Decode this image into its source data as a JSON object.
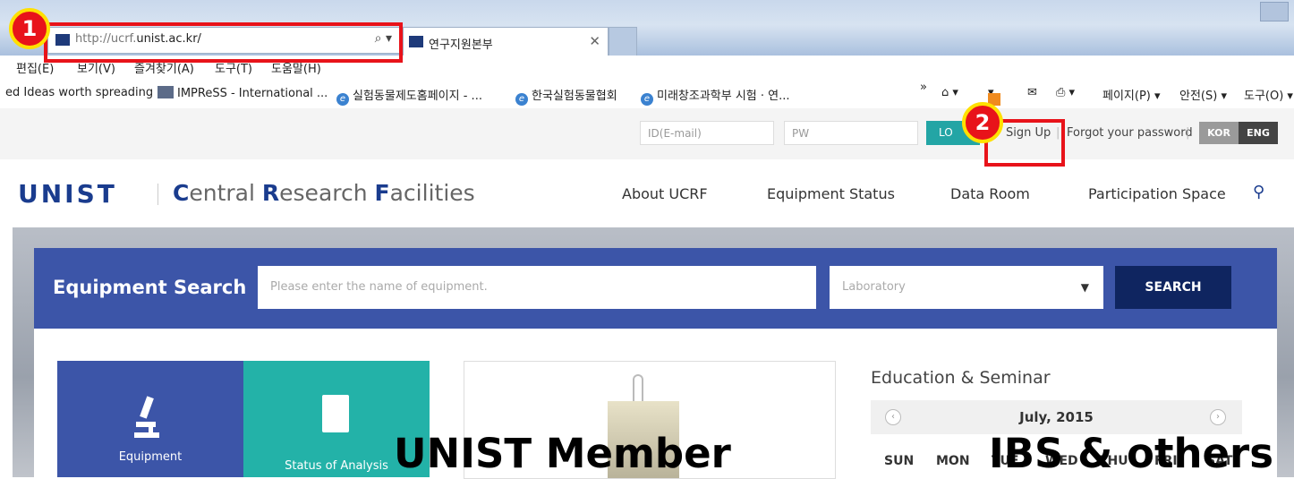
{
  "browser": {
    "url_prefix": "http://ucrf.",
    "url_host": "unist.ac.kr/",
    "tab_title": "연구지원본부",
    "menu": [
      "편집(E)",
      "보기(V)",
      "즐겨찾기(A)",
      "도구(T)",
      "도움말(H)"
    ],
    "favorites": [
      "ed Ideas worth spreading",
      "IMPReSS - International ...",
      "실험동물제도홈페이지 - ...",
      "한국실험동물협회",
      "미래창조과학부 시험 · 연..."
    ],
    "toolbar": [
      "»",
      "페이지(P) ▾",
      "안전(S) ▾",
      "도구(O) ▾"
    ]
  },
  "topbar": {
    "id_placeholder": "ID(E-mail)",
    "pw_placeholder": "PW",
    "login_label": "LO",
    "signup_label": "Sign Up",
    "forgot_label": "Forgot your password",
    "lang_kor": "KOR",
    "lang_eng": "ENG"
  },
  "header": {
    "logo": "UNIST",
    "site_title": {
      "c": "C",
      "entral": "entral ",
      "r": "R",
      "esearch": "esearch ",
      "f": "F",
      "acilities": "acilities"
    },
    "nav": [
      "About UCRF",
      "Equipment Status",
      "Data Room",
      "Participation Space"
    ]
  },
  "search": {
    "label": "Equipment Search",
    "placeholder": "Please enter the name of equipment.",
    "select_value": "Laboratory",
    "button": "SEARCH"
  },
  "tiles": [
    "Equipment",
    "Status of Analysis"
  ],
  "education": {
    "title": "Education & Seminar",
    "month": "July, 2015",
    "days": [
      "SUN",
      "MON",
      "TUE",
      "WED",
      "THU",
      "FRI",
      "SAT"
    ]
  },
  "annotations": {
    "badge1": "1",
    "badge2": "2",
    "caption_left": "UNIST Member",
    "caption_right": "IBS & others"
  },
  "colors": {
    "highlight": "#e8131a",
    "badge_ring": "#ffe000",
    "brand": "#1a3c8e",
    "search_bg": "#3c55a8",
    "teal": "#23b2a8"
  }
}
